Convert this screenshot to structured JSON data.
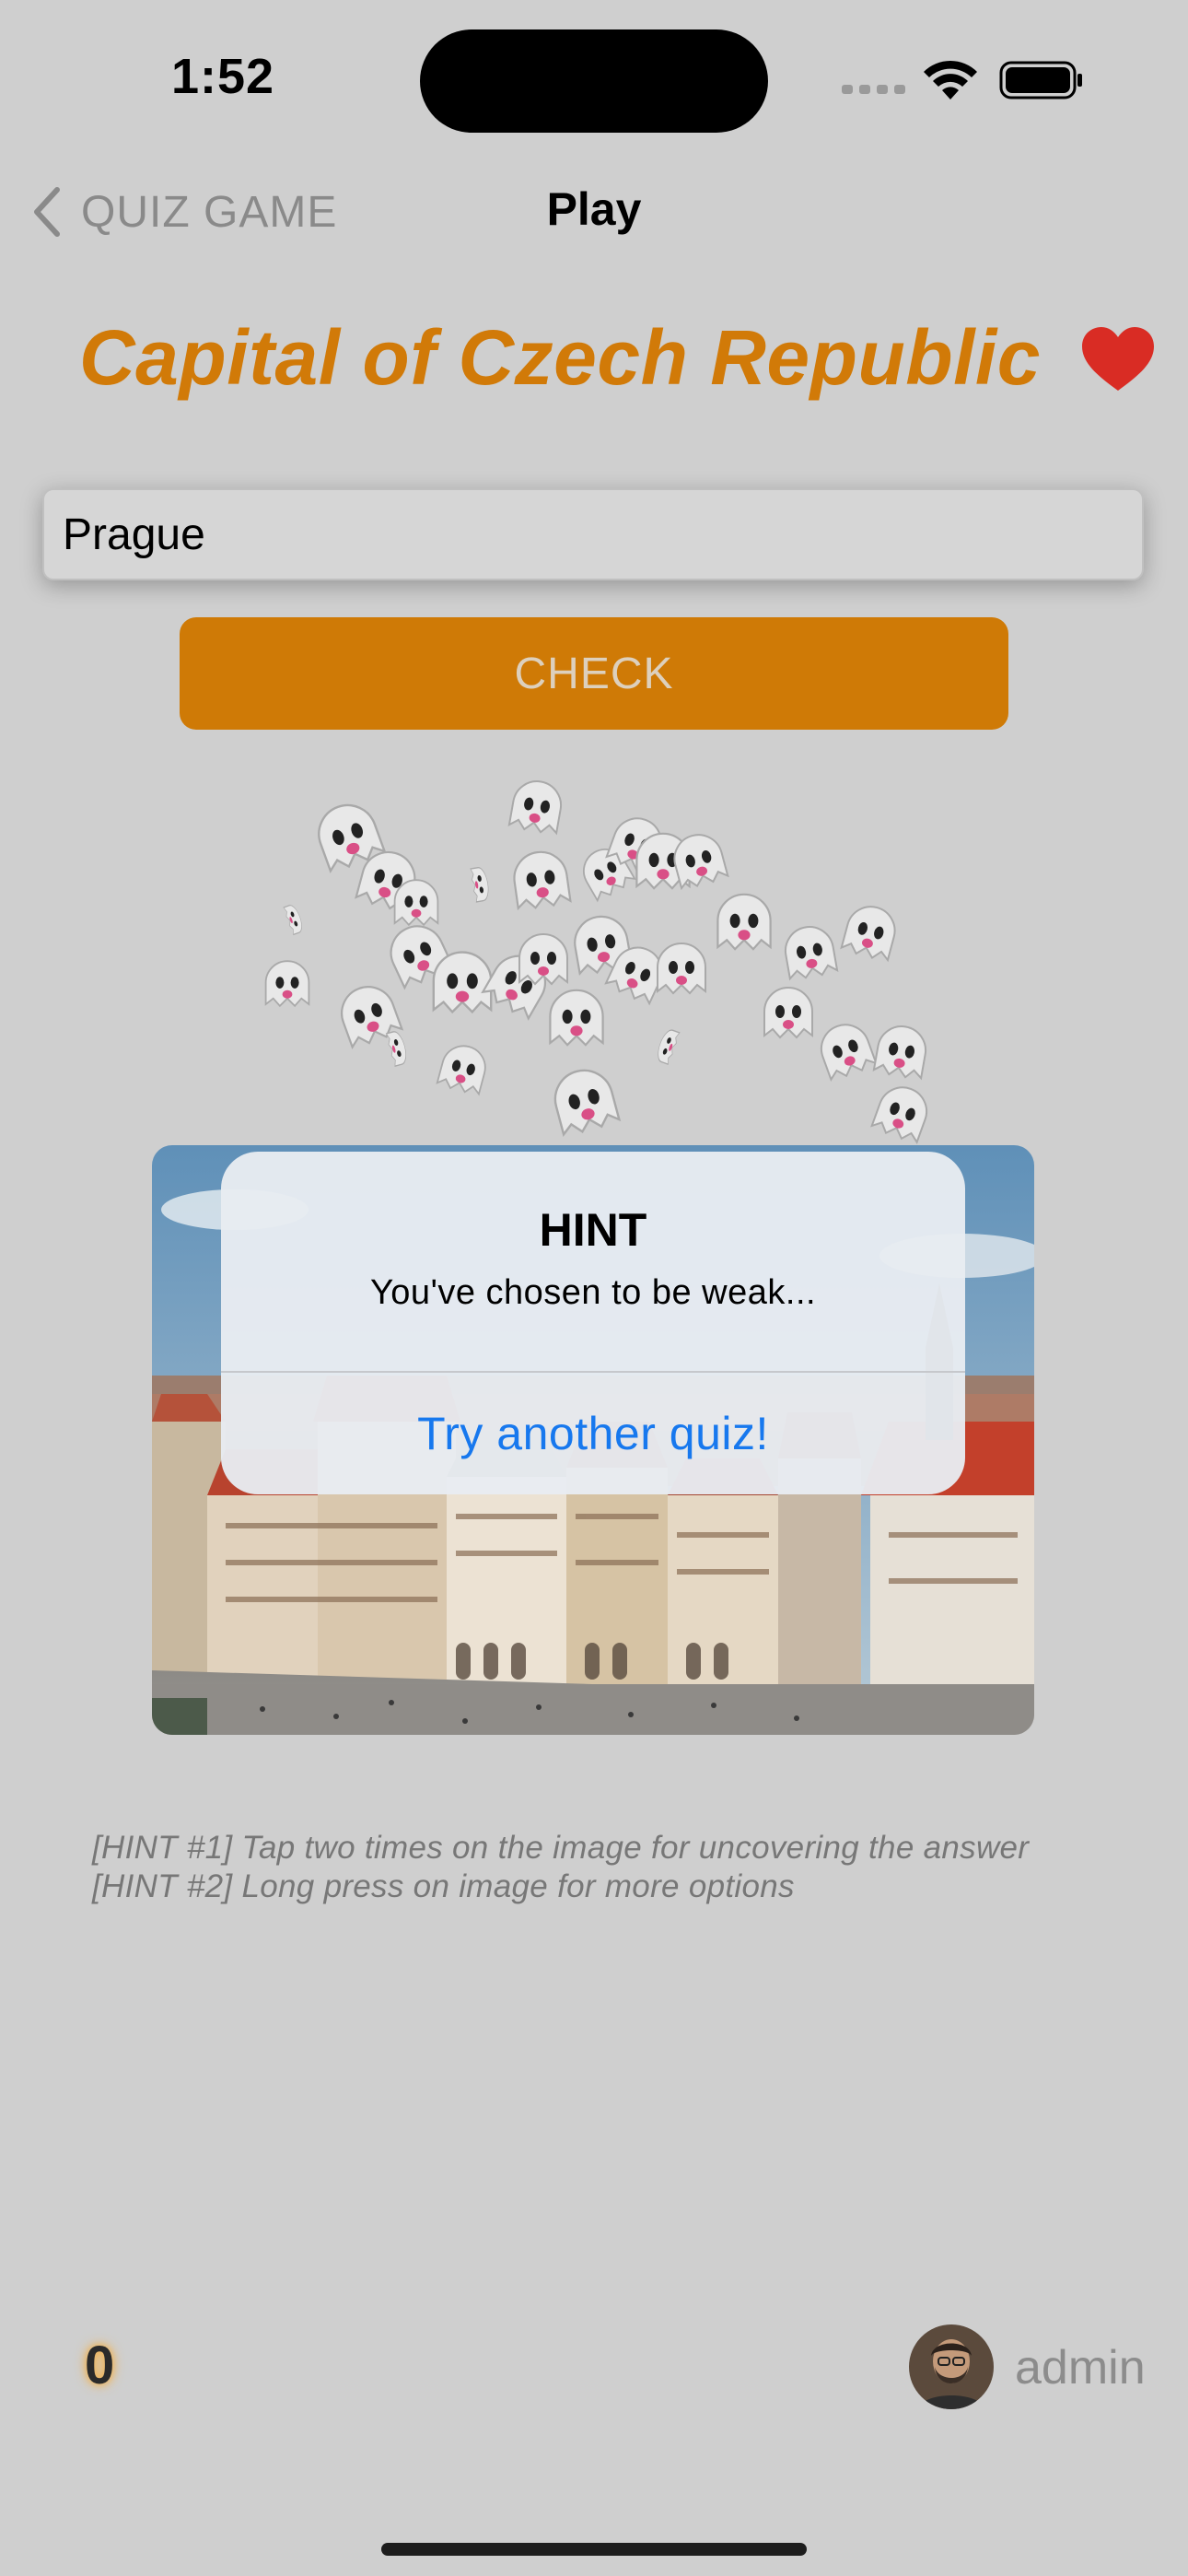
{
  "status_bar": {
    "time": "1:52"
  },
  "nav": {
    "back_label": "QUIZ GAME",
    "title": "Play"
  },
  "question": {
    "title": "Capital of Czech Republic"
  },
  "answer": {
    "value": "Prague"
  },
  "check_button": {
    "label": "CHECK"
  },
  "alert": {
    "title": "HINT",
    "message": "You've chosen to be weak...",
    "action_label": "Try another quiz!"
  },
  "hints": {
    "hint1": "[HINT #1] Tap two times on the image for uncovering the answer",
    "hint2": "[HINT #2] Long press on image for more options"
  },
  "footer": {
    "score": "0",
    "username": "admin"
  },
  "colors": {
    "background": "#cfcfcf",
    "accent_orange": "#cf7a06",
    "alert_link_blue": "#1778ee",
    "heart_red": "#d92c24"
  },
  "icons": {
    "back": "chevron-left-icon",
    "heart": "heart-icon",
    "wifi": "wifi-icon",
    "battery": "battery-icon",
    "confetti": "ghost-emoji"
  }
}
